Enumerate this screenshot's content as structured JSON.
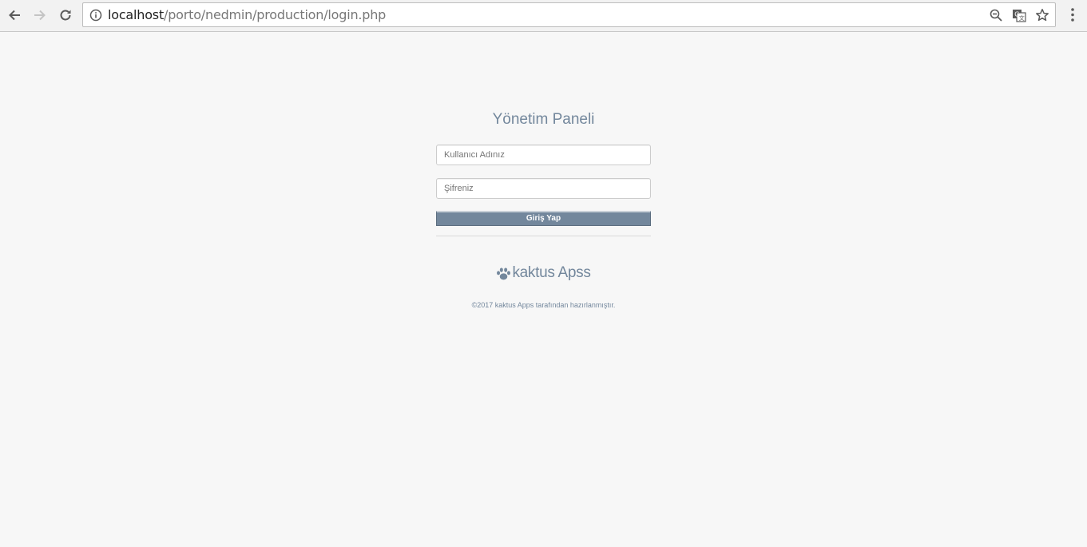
{
  "browser": {
    "url_host": "localhost",
    "url_path": "/porto/nedmin/production/login.php",
    "icons": {
      "back": "back-arrow-icon",
      "forward": "forward-arrow-icon",
      "reload": "reload-icon",
      "info": "info-icon",
      "zoom": "zoom-out-icon",
      "translate": "translate-icon",
      "bookmark": "star-icon",
      "menu": "kebab-menu-icon"
    }
  },
  "login": {
    "title": "Yönetim Paneli",
    "username_placeholder": "Kullanıcı Adınız",
    "password_placeholder": "Şifreniz",
    "submit_label": "Giriş Yap"
  },
  "footer": {
    "brand_name": "kaktus Apss",
    "copyright": "©2017 kaktus Apps tarafından hazırlanmıştır."
  },
  "colors": {
    "accent": "#73879c",
    "page_background": "#f7f7f7"
  }
}
